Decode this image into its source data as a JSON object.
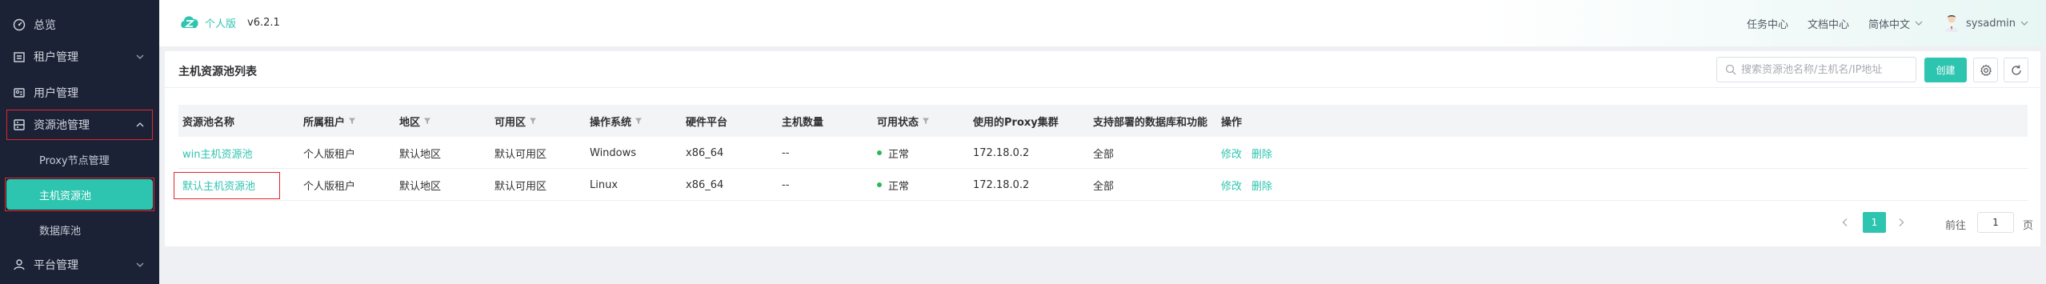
{
  "sidebar": {
    "items": [
      {
        "label": "总览",
        "icon": "dashboard-icon"
      },
      {
        "label": "租户管理",
        "icon": "tenant-icon"
      },
      {
        "label": "用户管理",
        "icon": "user-icon"
      },
      {
        "label": "资源池管理",
        "icon": "resource-pool-icon"
      },
      {
        "label": "平台管理",
        "icon": "platform-icon"
      }
    ],
    "sub_items": [
      {
        "label": "Proxy节点管理"
      },
      {
        "label": "主机资源池"
      },
      {
        "label": "数据库池"
      }
    ]
  },
  "header": {
    "brand": "个人版",
    "version": "v6.2.1",
    "links": [
      "任务中心",
      "文档中心"
    ],
    "language": "简体中文",
    "username": "sysadmin"
  },
  "card": {
    "title": "主机资源池列表",
    "search_placeholder": "搜索资源池名称/主机名/IP地址",
    "create_label": "创建"
  },
  "table": {
    "columns": [
      "资源池名称",
      "所属租户",
      "地区",
      "可用区",
      "操作系统",
      "硬件平台",
      "主机数量",
      "可用状态",
      "使用的Proxy集群",
      "支持部署的数据库和功能",
      "操作"
    ],
    "rows": [
      {
        "name": "win主机资源池",
        "tenant": "个人版租户",
        "region": "默认地区",
        "zone": "默认可用区",
        "os": "Windows",
        "arch": "x86_64",
        "hosts": "--",
        "status": "正常",
        "proxy": "172.18.0.2",
        "support": "全部",
        "edit": "修改",
        "delete": "删除"
      },
      {
        "name": "默认主机资源池",
        "tenant": "个人版租户",
        "region": "默认地区",
        "zone": "默认可用区",
        "os": "Linux",
        "arch": "x86_64",
        "hosts": "--",
        "status": "正常",
        "proxy": "172.18.0.2",
        "support": "全部",
        "edit": "修改",
        "delete": "删除"
      }
    ]
  },
  "pagination": {
    "current": "1",
    "goto_label": "前往",
    "goto_value": "1",
    "page_suffix": "页"
  },
  "colors": {
    "accent": "#2ec5b0",
    "sidebar_bg": "#1c2236",
    "status_ok": "#2bb85a",
    "highlight_border": "#e2262b"
  }
}
